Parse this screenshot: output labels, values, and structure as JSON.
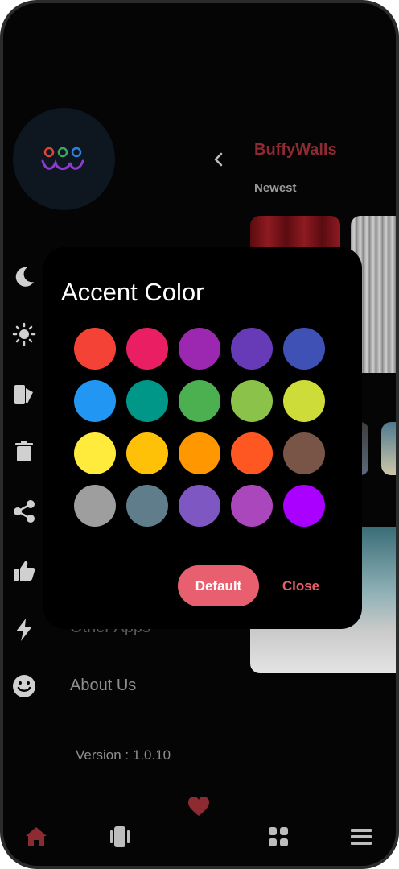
{
  "app": {
    "title": "BuffyWalls",
    "subtitle": "Newest"
  },
  "drawer": {
    "items": [
      {
        "label": "Other Apps"
      },
      {
        "label": "About Us"
      }
    ],
    "version": "Version : 1.0.10"
  },
  "dialog": {
    "title": "Accent Color",
    "swatches": [
      "#f44336",
      "#e91e63",
      "#9c27b0",
      "#673ab7",
      "#3f51b5",
      "#2196f3",
      "#009688",
      "#4caf50",
      "#8bc34a",
      "#cddc39",
      "#ffeb3b",
      "#ffc107",
      "#ff9800",
      "#ff5722",
      "#795548",
      "#9e9e9e",
      "#607d8b",
      "#7e57c2",
      "#ab47bc",
      "#aa00ff"
    ],
    "default_label": "Default",
    "close_label": "Close"
  },
  "colors": {
    "accent": "#e86070",
    "brand": "#8e2b32"
  },
  "icons": {
    "sidebar": [
      "moon-icon",
      "brightness-icon",
      "theme-icon",
      "trash-icon",
      "share-icon",
      "thumbs-up-icon",
      "flash-icon",
      "smiley-icon"
    ],
    "bottom_nav": [
      "home-icon",
      "phone-icon",
      "grid-icon",
      "menu-icon"
    ]
  }
}
